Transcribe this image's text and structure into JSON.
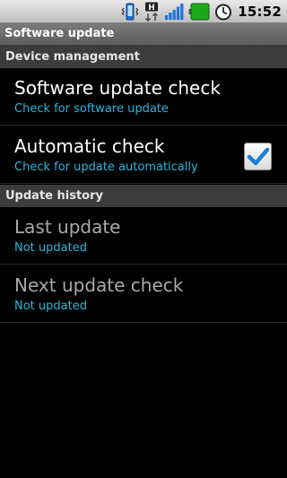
{
  "status_bar": {
    "time": "15:52",
    "icons": [
      "vibrate-icon",
      "hspa-data-icon",
      "signal-icon",
      "battery-icon",
      "alarm-clock-icon"
    ],
    "network_letter": "H"
  },
  "title_bar": {
    "title": "Software update"
  },
  "sections": [
    {
      "header": "Device management",
      "items": [
        {
          "title": "Software update check",
          "subtitle": "Check for software update",
          "enabled": true
        },
        {
          "title": "Automatic check",
          "subtitle": "Check for update automatically",
          "enabled": true,
          "checkbox": true,
          "checked": true
        }
      ]
    },
    {
      "header": "Update history",
      "items": [
        {
          "title": "Last update",
          "subtitle": "Not updated",
          "enabled": false
        },
        {
          "title": "Next update check",
          "subtitle": "Not updated",
          "enabled": false
        }
      ]
    }
  ],
  "colors": {
    "accent": "#27b7de",
    "checkmark": "#1e7fd6",
    "battery": "#1aa81a"
  }
}
